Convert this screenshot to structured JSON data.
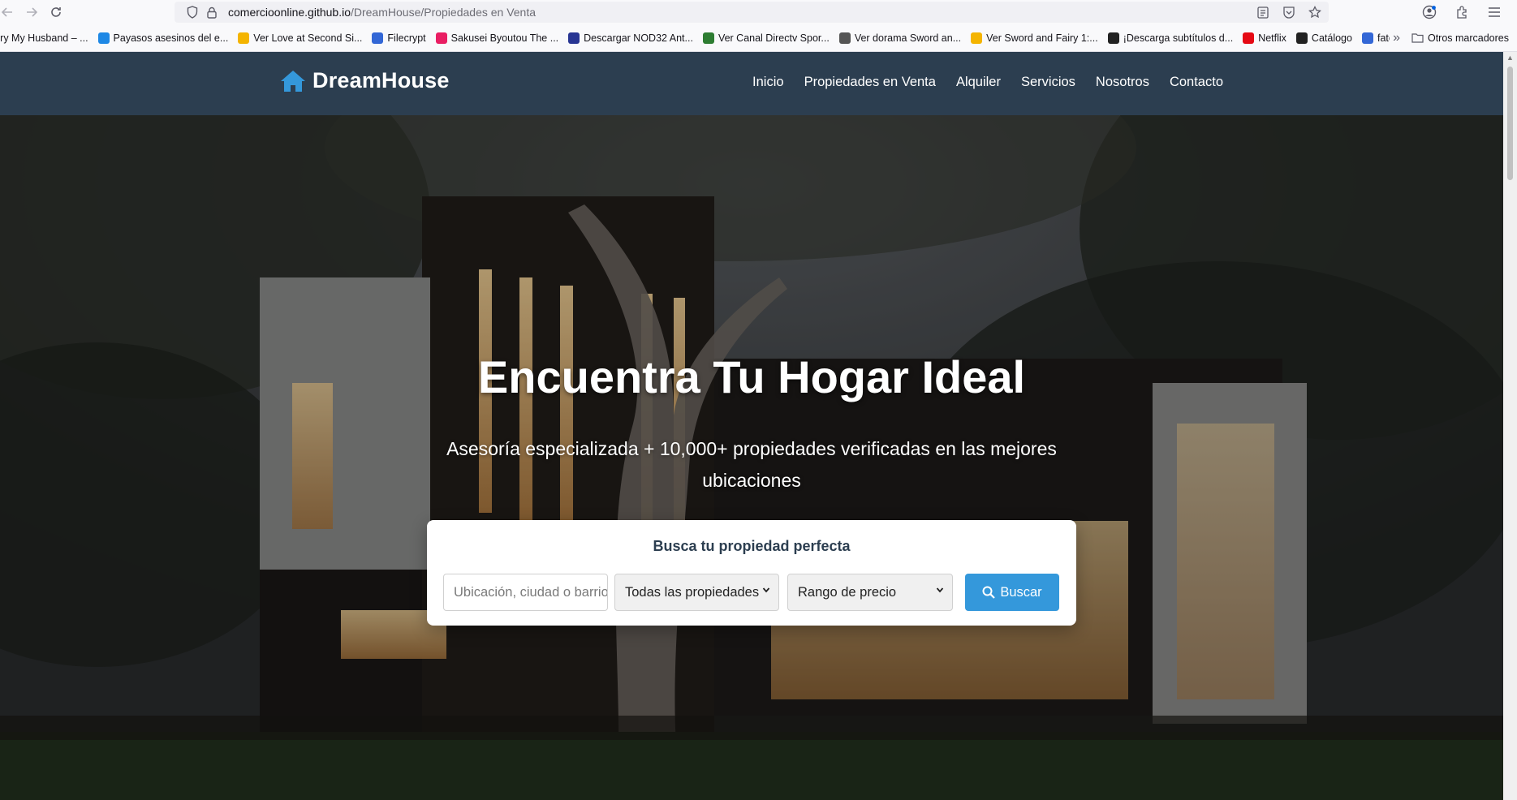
{
  "browser": {
    "url_host": "comercioonline.github.io",
    "url_path": "/DreamHouse/Propiedades en Venta",
    "bookmarks": [
      {
        "label": "rry My Husband – ...",
        "color": "#e0e0e0"
      },
      {
        "label": "Payasos asesinos del e...",
        "color": "#1e88e5"
      },
      {
        "label": "Ver Love at Second Si...",
        "color": "#f4b400"
      },
      {
        "label": "Filecrypt",
        "color": "#3367d6"
      },
      {
        "label": "Sakusei Byoutou The ...",
        "color": "#e91e63"
      },
      {
        "label": "Descargar NOD32 Ant...",
        "color": "#283593"
      },
      {
        "label": "Ver Canal Directv Spor...",
        "color": "#2e7d32"
      },
      {
        "label": "Ver dorama Sword an...",
        "color": "#555555"
      },
      {
        "label": "Ver Sword and Fairy 1:...",
        "color": "#f4b400"
      },
      {
        "label": "¡Descarga subtítulos d...",
        "color": "#222222"
      },
      {
        "label": "Netflix",
        "color": "#e50914"
      },
      {
        "label": "Catálogo",
        "color": "#222222"
      },
      {
        "label": "fate to you",
        "color": "#3367d6"
      }
    ],
    "bookmarks_more": "»",
    "other_bookmarks": "Otros marcadores"
  },
  "site": {
    "brand": "DreamHouse",
    "brand_icon": "home-icon",
    "nav": [
      "Inicio",
      "Propiedades en Venta",
      "Alquiler",
      "Servicios",
      "Nosotros",
      "Contacto"
    ],
    "colors": {
      "header": "#2c3e50",
      "accent": "#3498db"
    }
  },
  "hero": {
    "title": "Encuentra Tu Hogar Ideal",
    "subtitle": "Asesoría especializada + 10,000+ propiedades verificadas en las mejores ubicaciones"
  },
  "search": {
    "title": "Busca tu propiedad perfecta",
    "location_placeholder": "Ubicación, ciudad o barrio",
    "type_selected": "Todas las propiedades",
    "price_selected": "Rango de precio",
    "button_label": "Buscar",
    "button_icon": "search-icon"
  }
}
